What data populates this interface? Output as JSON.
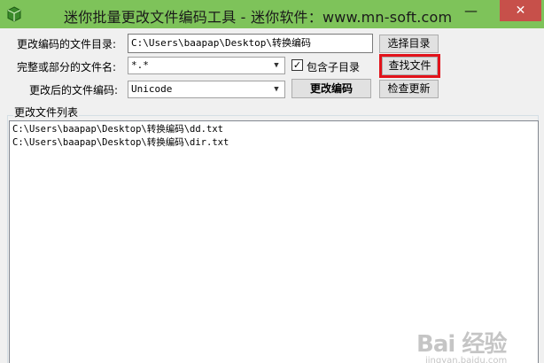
{
  "window": {
    "title": "迷你批量更改文件编码工具 - 迷你软件：www.mn-soft.com",
    "minimize_glyph": "—",
    "close_glyph": "✕"
  },
  "form": {
    "dir_label": "更改编码的文件目录:",
    "dir_value": "C:\\Users\\baapap\\Desktop\\转换编码",
    "browse_button": "选择目录",
    "name_label": "完整或部分的文件名:",
    "name_value": "*.*",
    "include_sub_checked": true,
    "include_sub_label": "包含子目录",
    "find_button": "查找文件",
    "encoding_label": "更改后的文件编码:",
    "encoding_value": "Unicode",
    "change_button": "更改编码",
    "update_button": "检查更新",
    "check_glyph": "✓",
    "arrow_glyph": "▼"
  },
  "file_list": {
    "label": "更改文件列表",
    "items": [
      "C:\\Users\\baapap\\Desktop\\转换编码\\dd.txt",
      "C:\\Users\\baapap\\Desktop\\转换编码\\dir.txt"
    ]
  },
  "watermark": {
    "brand": "Bai 经验",
    "url": "jingyan.baidu.com"
  },
  "colors": {
    "titlebar": "#7ec35a",
    "close": "#c7504a",
    "highlight": "#e2121a"
  }
}
